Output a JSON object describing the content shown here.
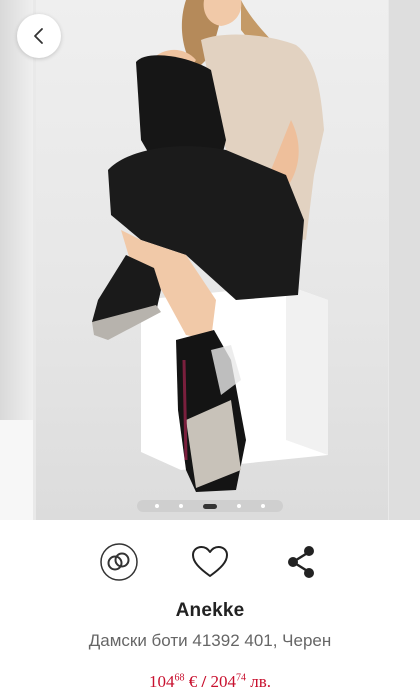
{
  "gallery": {
    "image_alt_icon": "product-photo",
    "slide_count": 5,
    "active_slide": 3
  },
  "icons": {
    "back": "chevron-left-icon",
    "compare": "compare-rings-icon",
    "favorite": "heart-icon",
    "share": "share-icon"
  },
  "product": {
    "brand": "Anekke",
    "title": "Дамски боти 41392 401, Черен",
    "price_eur_main": "104",
    "price_eur_cents": "68",
    "price_eur_currency": "€",
    "price_separator": "/",
    "price_bgn_main": "204",
    "price_bgn_cents": "74",
    "price_bgn_currency": "лв."
  },
  "colors": {
    "price": "#c8102e",
    "brand": "#222222",
    "title": "#666666"
  }
}
